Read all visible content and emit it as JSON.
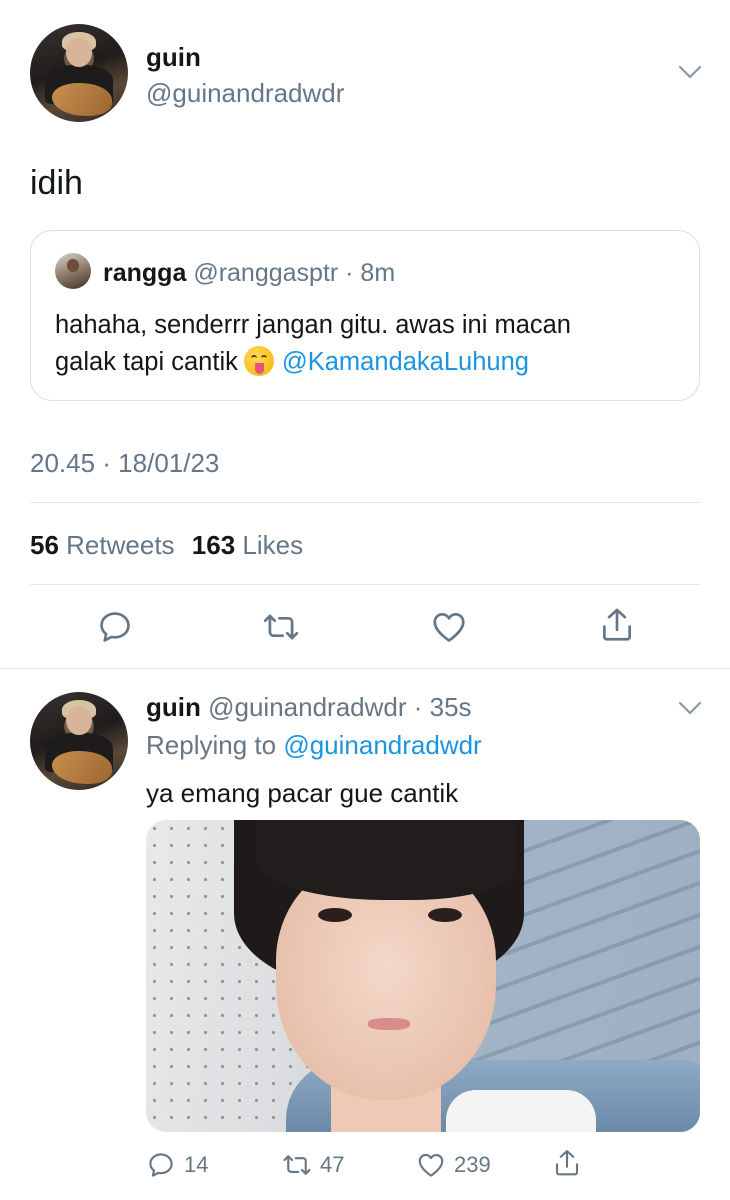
{
  "tweet": {
    "name": "guin",
    "handle": "@guinandradwdr",
    "text": "idih",
    "timestamp": "20.45 · 18/01/23",
    "stats": {
      "retweets_count": "56",
      "retweets_label": "Retweets",
      "likes_count": "163",
      "likes_label": "Likes"
    },
    "actions": [
      "reply-icon",
      "retweet-icon",
      "like-icon",
      "share-icon"
    ]
  },
  "quote": {
    "name": "rangga",
    "meta": "@ranggasptr · 8m",
    "text_line1": "hahaha, senderrr jangan gitu. awas ini macan",
    "text_line2": "galak tapi cantik",
    "emoji": "face-with-tongue",
    "mention": "@KamandakaLuhung"
  },
  "reply": {
    "name": "guin",
    "meta": "@guinandradwdr · 35s",
    "replying_prefix": "Replying to",
    "replying_to": "@guinandradwdr",
    "text": "ya emang pacar gue cantik",
    "reply_count": "14",
    "retweet_count": "47",
    "like_count": "239"
  },
  "colors": {
    "link": "#1b95e0",
    "secondary_text": "#657786",
    "divider": "#e1e8ed"
  }
}
